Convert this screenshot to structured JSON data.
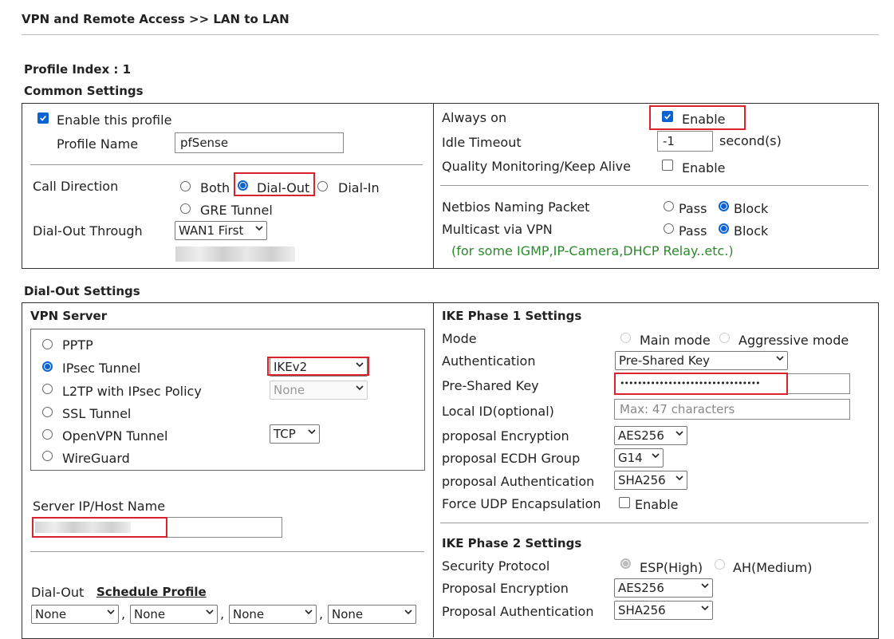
{
  "header": {
    "breadcrumb": "VPN and Remote Access >> LAN to LAN"
  },
  "profile_index": "Profile Index : 1",
  "common": {
    "title": "Common Settings",
    "enable_profile_label": "Enable this profile",
    "profile_name_label": "Profile Name",
    "profile_name_value": "pfSense",
    "call_direction_label": "Call Direction",
    "call_direction_options": [
      "Both",
      "Dial-Out",
      "Dial-In",
      "GRE Tunnel"
    ],
    "dial_out_through_label": "Dial-Out Through",
    "dial_out_through_value": "WAN1 First",
    "always_on_label": "Always on",
    "always_on_enable": "Enable",
    "idle_timeout_label": "Idle Timeout",
    "idle_timeout_value": "-1",
    "idle_timeout_unit": "second(s)",
    "quality_label": "Quality Monitoring/Keep Alive",
    "quality_enable": "Enable",
    "netbios_label": "Netbios Naming Packet",
    "multicast_label": "Multicast via VPN",
    "pass_label": "Pass",
    "block_label": "Block",
    "multicast_note": "(for some IGMP,IP-Camera,DHCP Relay..etc.)"
  },
  "dialout": {
    "title": "Dial-Out Settings",
    "vpn_server_title": "VPN Server",
    "vpn_types": [
      "PPTP",
      "IPsec Tunnel",
      "L2TP with IPsec Policy",
      "SSL Tunnel",
      "OpenVPN Tunnel",
      "WireGuard"
    ],
    "ipsec_mode": "IKEv2",
    "l2tp_policy": "None",
    "openvpn_proto": "TCP",
    "server_ip_label": "Server IP/Host Name",
    "dialout_label": "Dial-Out",
    "schedule_link": "Schedule Profile",
    "schedule_values": [
      "None",
      "None",
      "None",
      "None"
    ]
  },
  "ike1": {
    "title": "IKE Phase 1 Settings",
    "mode_label": "Mode",
    "main_mode": "Main mode",
    "aggressive_mode": "Aggressive mode",
    "auth_label": "Authentication",
    "auth_value": "Pre-Shared Key",
    "psk_label": "Pre-Shared Key",
    "psk_value": "••••••••••••••••••••••••••••••••",
    "local_id_label": "Local ID(optional)",
    "local_id_placeholder": "Max: 47 characters",
    "enc_label": "proposal Encryption",
    "enc_value": "AES256",
    "ecdh_label": "proposal ECDH Group",
    "ecdh_value": "G14",
    "auth2_label": "proposal Authentication",
    "auth2_value": "SHA256",
    "udp_label": "Force UDP Encapsulation",
    "udp_enable": "Enable"
  },
  "ike2": {
    "title": "IKE Phase 2 Settings",
    "sec_label": "Security Protocol",
    "esp": "ESP(High)",
    "ah": "AH(Medium)",
    "enc_label": "Proposal Encryption",
    "enc_value": "AES256",
    "auth_label": "Proposal Authentication",
    "auth_value": "SHA256"
  },
  "colors": {
    "highlight": "#d9232d",
    "accent": "#0b63d1",
    "note": "#2a8a2a"
  }
}
